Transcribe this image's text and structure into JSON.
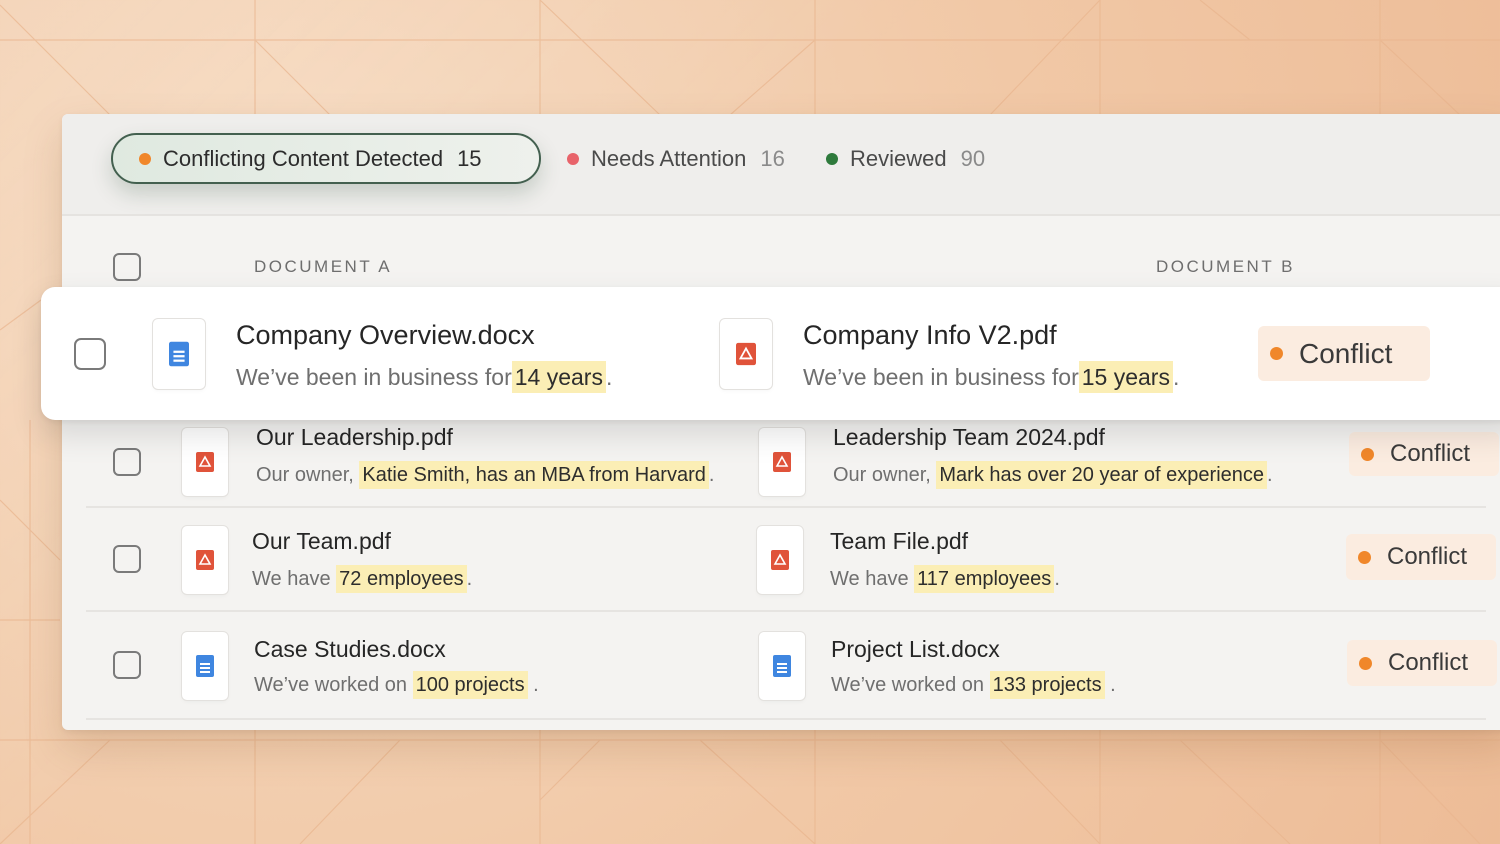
{
  "colors": {
    "orange": "#f0872a",
    "red": "#e8636a",
    "green": "#2e7a3c",
    "highlight": "#fbeeb5",
    "badge_bg": "#fbece0"
  },
  "filters": {
    "active": {
      "label": "Conflicting Content Detected",
      "count": "15"
    },
    "needs_attention": {
      "label": "Needs Attention",
      "count": "16"
    },
    "reviewed": {
      "label": "Reviewed",
      "count": "90"
    }
  },
  "table": {
    "col_a": "DOCUMENT A",
    "col_b": "DOCUMENT B",
    "rows": [
      {
        "a": {
          "file": "Company Overview.docx",
          "type": "doc",
          "prefix": "We’ve been in business for",
          "highlight": "14 years",
          "suffix": "."
        },
        "b": {
          "file": "Company Info V2.pdf",
          "type": "pdf",
          "prefix": "We’ve been in business for",
          "highlight": "15 years",
          "suffix": "."
        },
        "status": "Conflict"
      },
      {
        "a": {
          "file": "Our Leadership.pdf",
          "type": "pdf",
          "prefix": "Our owner,",
          "highlight": "Katie Smith, has an MBA from Harvard",
          "suffix": "."
        },
        "b": {
          "file": "Leadership Team 2024.pdf",
          "type": "pdf",
          "prefix": "Our owner,",
          "highlight": "Mark has over 20 year of experience",
          "suffix": "."
        },
        "status": "Conflict"
      },
      {
        "a": {
          "file": "Our Team.pdf",
          "type": "pdf",
          "prefix": "We have",
          "highlight": "72 employees",
          "suffix": "."
        },
        "b": {
          "file": "Team File.pdf",
          "type": "pdf",
          "prefix": "We have",
          "highlight": "117 employees",
          "suffix": "."
        },
        "status": "Conflict"
      },
      {
        "a": {
          "file": "Case Studies.docx",
          "type": "doc",
          "prefix": "We’ve worked on",
          "highlight": "100 projects",
          "suffix": "."
        },
        "b": {
          "file": "Project List.docx",
          "type": "doc",
          "prefix": "We’ve worked on",
          "highlight": "133 projects",
          "suffix": "."
        },
        "status": "Conflict"
      }
    ]
  }
}
